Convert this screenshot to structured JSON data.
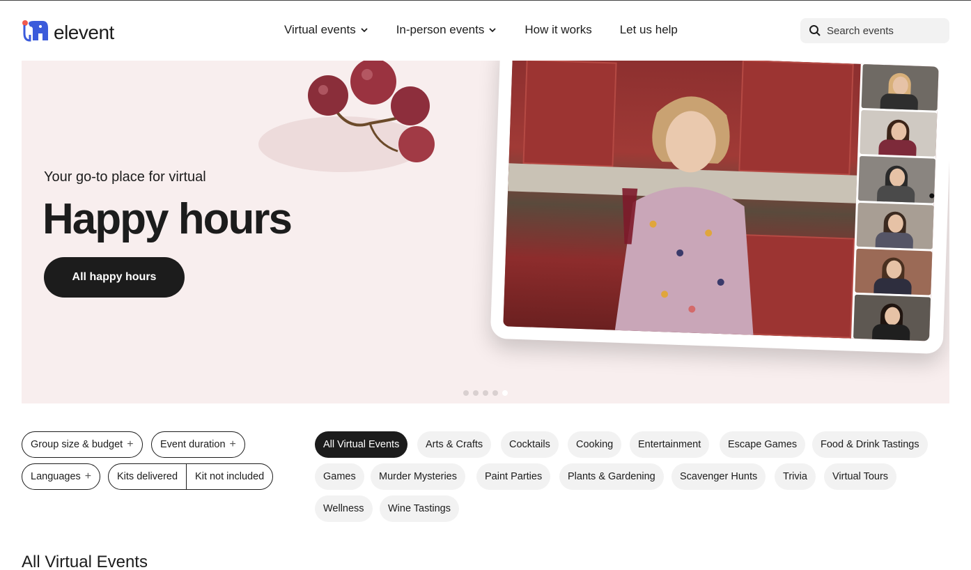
{
  "brand": {
    "name": "elevent",
    "accent": "#3b5bdb",
    "dot_color": "#f05a4f"
  },
  "nav": {
    "items": [
      {
        "label": "Virtual events",
        "has_dropdown": true
      },
      {
        "label": "In-person events",
        "has_dropdown": true
      },
      {
        "label": "How it works",
        "has_dropdown": false
      },
      {
        "label": "Let us help",
        "has_dropdown": false
      }
    ]
  },
  "search": {
    "placeholder": "Search events",
    "icon": "search-icon"
  },
  "hero": {
    "subtitle": "Your go-to place for virtual",
    "title": "Happy hours",
    "cta_label": "All happy hours",
    "carousel_slides": 5,
    "carousel_active_index": 4,
    "background": "#f8eeee"
  },
  "filters": {
    "group_size": "Group size & budget",
    "duration": "Event duration",
    "languages": "Languages",
    "kits": [
      "Kits delivered",
      "Kit not included"
    ]
  },
  "categories": {
    "active": "All Virtual Events",
    "items": [
      "All Virtual Events",
      "Arts & Crafts",
      "Cocktails",
      "Cooking",
      "Entertainment",
      "Escape Games",
      "Food & Drink Tastings",
      "Games",
      "Murder Mysteries",
      "Paint Parties",
      "Plants & Gardening",
      "Scavenger Hunts",
      "Trivia",
      "Virtual Tours",
      "Wellness",
      "Wine Tastings"
    ]
  },
  "section": {
    "title": "All Virtual Events"
  }
}
